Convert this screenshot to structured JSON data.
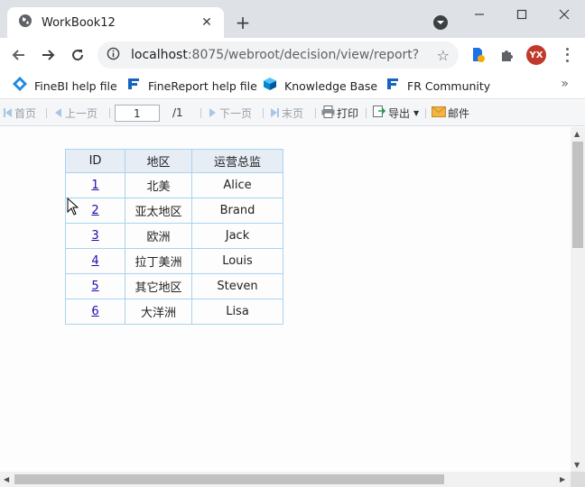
{
  "browser": {
    "tab_title": "WorkBook12",
    "url_host": "localhost",
    "url_rest": ":8075/webroot/decision/view/report?...",
    "profile_initials": "YX",
    "bookmarks": [
      {
        "label": "FineBI help file",
        "icon": "finebi-icon"
      },
      {
        "label": "FineReport help file",
        "icon": "finereport-icon"
      },
      {
        "label": "Knowledge Base",
        "icon": "cube-icon"
      },
      {
        "label": "FR Community",
        "icon": "finereport-icon"
      }
    ]
  },
  "report_toolbar": {
    "first": "首页",
    "prev": "上一页",
    "page_value": "1",
    "total": "/1",
    "next": "下一页",
    "last": "末页",
    "print": "打印",
    "export": "导出",
    "email": "邮件"
  },
  "table": {
    "headers": [
      "ID",
      "地区",
      "运营总监"
    ],
    "rows": [
      {
        "id": "1",
        "region": "北美",
        "director": "Alice"
      },
      {
        "id": "2",
        "region": "亚太地区",
        "director": "Brand"
      },
      {
        "id": "3",
        "region": "欧洲",
        "director": "Jack"
      },
      {
        "id": "4",
        "region": "拉丁美洲",
        "director": "Louis"
      },
      {
        "id": "5",
        "region": "其它地区",
        "director": "Steven"
      },
      {
        "id": "6",
        "region": "大洋洲",
        "director": "Lisa"
      }
    ]
  },
  "colors": {
    "table_border": "#a8d3f0",
    "header_bg": "#e6edf5",
    "link": "#1a0dab",
    "avatar": "#c0392b"
  }
}
